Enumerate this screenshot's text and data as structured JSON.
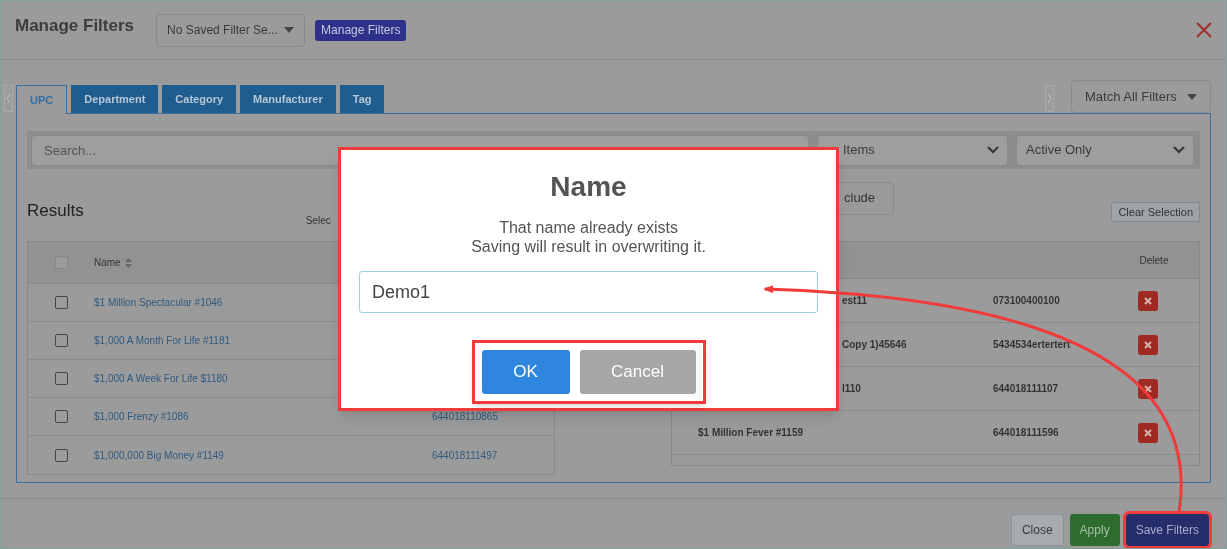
{
  "header": {
    "title": "Manage Filters",
    "saved_filter_select": {
      "value": "No Saved Filter Se..."
    },
    "manage_button": "Manage Filters"
  },
  "tabs": [
    {
      "label": "UPC",
      "selected": true
    },
    {
      "label": "Department",
      "selected": false
    },
    {
      "label": "Category",
      "selected": false
    },
    {
      "label": "Manufacturer",
      "selected": false
    },
    {
      "label": "Tag",
      "selected": false
    }
  ],
  "match_select": {
    "value": "Match All Filters"
  },
  "search": {
    "placeholder": "Search..."
  },
  "filter_selects": [
    {
      "value": "Items",
      "cut": true
    },
    {
      "value": "Active Only"
    }
  ],
  "results": {
    "title": "Results",
    "select_label": "Selec",
    "header_checked": false,
    "columns": [
      "Name"
    ],
    "rows": [
      {
        "name": "$1 Million Spectacular #1046",
        "upc": "",
        "checked": false
      },
      {
        "name": "$1,000 A Month For Life #1181",
        "upc": "",
        "checked": false
      },
      {
        "name": "$1,000 A Week For Life $1180",
        "upc": "",
        "checked": false
      },
      {
        "name": "$1,000 Frenzy #1086",
        "upc": "644018110865",
        "checked": false
      },
      {
        "name": "$1,000,000 Big Money #1149",
        "upc": "644018111497",
        "checked": false
      }
    ]
  },
  "selection": {
    "exclude_button": "clude",
    "clear_button": "Clear Selection",
    "columns": [
      "Delete"
    ],
    "rows": [
      {
        "name": "est11",
        "upc": "073100400100",
        "cut": true
      },
      {
        "name": "Copy 1)45646",
        "upc": "5434534ertertert",
        "cut": true
      },
      {
        "name": "l110",
        "upc": "644018111107",
        "cut": true
      },
      {
        "name": "$1 Million Fever #1159",
        "upc": "644018111596"
      }
    ]
  },
  "dialog": {
    "title": "Name",
    "messages": [
      "That name already exists",
      "Saving will result in overwriting it."
    ],
    "input_value": "Demo1",
    "buttons_highlighted": true,
    "buttons": [
      {
        "label": "OK",
        "kind": "primary"
      },
      {
        "label": "Cancel",
        "kind": "secondary"
      }
    ]
  },
  "footer": {
    "buttons": [
      {
        "label": "Close",
        "kind": "close",
        "highlighted": false
      },
      {
        "label": "Apply",
        "kind": "apply",
        "highlighted": false
      },
      {
        "label": "Save Filters",
        "kind": "save",
        "highlighted": true
      }
    ]
  }
}
